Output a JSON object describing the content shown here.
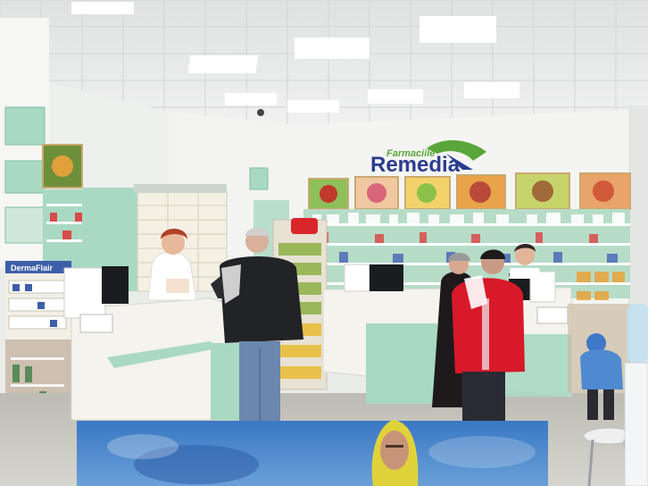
{
  "sign": {
    "small": "Farmaciile",
    "big": "Remedia"
  },
  "stand_label": "DermaFlair",
  "colors": {
    "wall": "#f2f3f1",
    "ceiling": "#e9ebea",
    "mint": "#a9d9c2",
    "mint_dark": "#7fbf9f",
    "sign_blue": "#2b3d8f",
    "sign_green": "#5aa63a",
    "counter": "#f3f2ec",
    "floor": "#c8c7bf",
    "jacket_red": "#d8192a",
    "jacket_black": "#222326",
    "banner_sky": "#4f86c9"
  }
}
